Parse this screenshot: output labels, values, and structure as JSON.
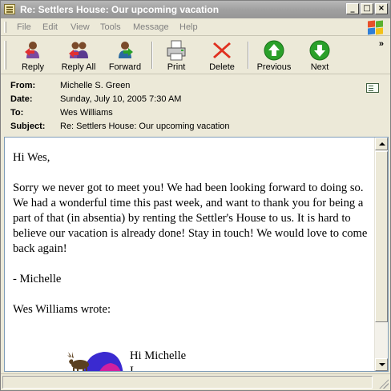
{
  "window": {
    "title": "Re: Settlers House:  Our upcoming vacation",
    "controls": {
      "minimize": "_",
      "maximize": "□",
      "close": "×"
    }
  },
  "menu": [
    "File",
    "Edit",
    "View",
    "Tools",
    "Message",
    "Help"
  ],
  "toolbar": {
    "reply": "Reply",
    "reply_all": "Reply All",
    "forward": "Forward",
    "print": "Print",
    "delete": "Delete",
    "previous": "Previous",
    "next": "Next",
    "more": "»"
  },
  "header": {
    "from_label": "From:",
    "from": "Michelle S. Green",
    "date_label": "Date:",
    "date": "Sunday, July 10, 2005 7:30 AM",
    "to_label": "To:",
    "to": "Wes Williams",
    "subject_label": "Subject:",
    "subject": "Re: Settlers House:  Our upcoming vacation"
  },
  "message": {
    "greeting": "Hi Wes,",
    "paragraph": "Sorry we never got to meet you!  We had been looking forward to doing so. We had a wonderful time this past week, and want to thank you for being a part of that (in absentia) by renting the Settler's House to us.  It is hard to believe our vacation is already done!  Stay in touch!  We would love to come back again!",
    "signoff": "- Michelle",
    "quote_intro": "Wes Williams wrote:",
    "quoted_greeting": "Hi Michelle",
    "quoted_line_partial": "I  …"
  },
  "colors": {
    "titlebar": "#a0a0a0",
    "chrome": "#ece9d8",
    "reply_green": "#2aa02a",
    "delete_red": "#e03020"
  }
}
